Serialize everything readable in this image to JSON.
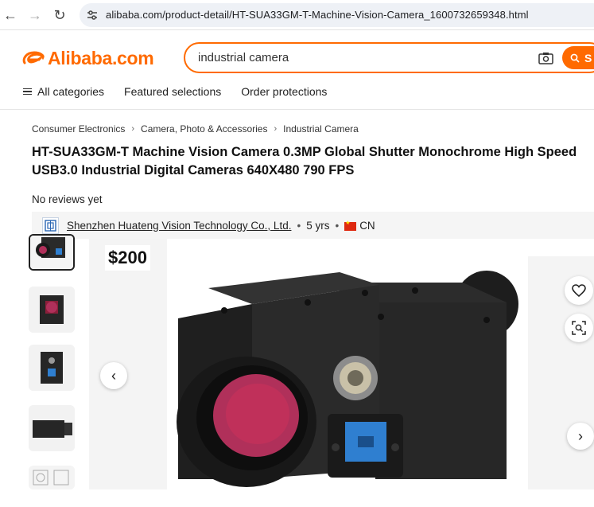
{
  "browser": {
    "url": "alibaba.com/product-detail/HT-SUA33GM-T-Machine-Vision-Camera_1600732659348.html"
  },
  "header": {
    "logo_text": "Alibaba.com",
    "search_value": "industrial camera",
    "search_button_label": "S",
    "nav": [
      "All categories",
      "Featured selections",
      "Order protections"
    ]
  },
  "breadcrumb": [
    "Consumer Electronics",
    "Camera, Photo & Accessories",
    "Industrial Camera"
  ],
  "product": {
    "title": "HT-SUA33GM-T Machine Vision Camera 0.3MP Global Shutter Monochrome High Speed USB3.0 Industrial Digital Cameras 640X480 790 FPS",
    "reviews": "No reviews yet",
    "price": "$200"
  },
  "supplier": {
    "name": "Shenzhen Huateng Vision Technology Co., Ltd.",
    "years": "5 yrs",
    "country": "CN"
  },
  "colors": {
    "brand": "#ff6a00",
    "usb_port": "#2f7fd0",
    "lens_filter": "#c0305a"
  }
}
